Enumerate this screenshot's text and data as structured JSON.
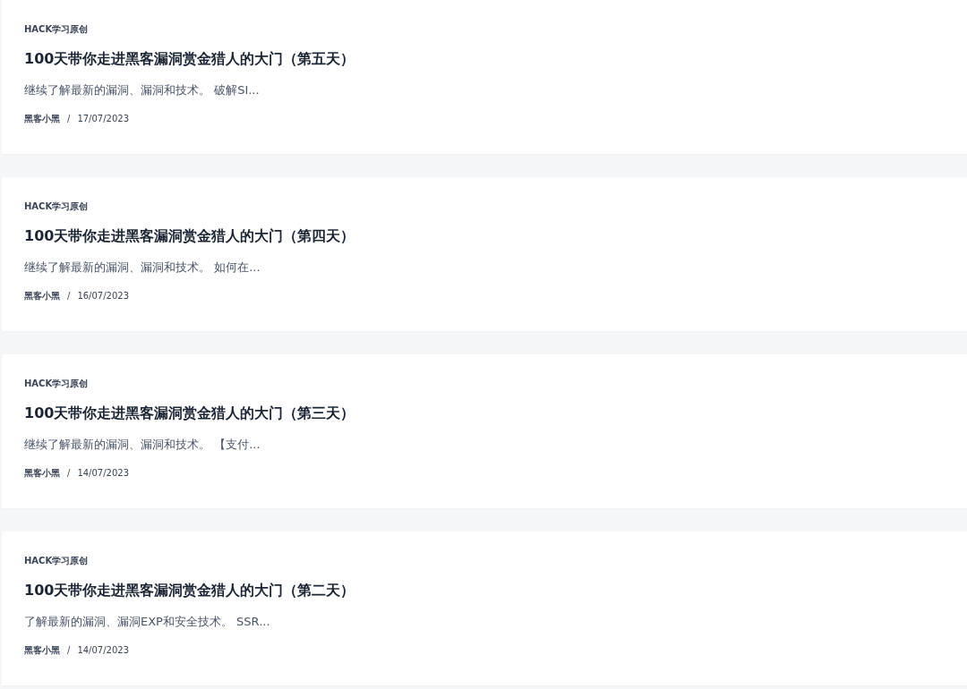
{
  "posts": [
    {
      "category": "HACK学习原创",
      "title": "100天带你走进黑客漏洞赏金猎人的大门（第五天）",
      "excerpt": "继续了解最新的漏洞、漏洞和技术。 破解SI...",
      "author": "黑客小黑",
      "separator": "/",
      "date": "17/07/2023"
    },
    {
      "category": "HACK学习原创",
      "title": "100天带你走进黑客漏洞赏金猎人的大门（第四天）",
      "excerpt": "继续了解最新的漏洞、漏洞和技术。 如何在...",
      "author": "黑客小黑",
      "separator": "/",
      "date": "16/07/2023"
    },
    {
      "category": "HACK学习原创",
      "title": "100天带你走进黑客漏洞赏金猎人的大门（第三天）",
      "excerpt": "继续了解最新的漏洞、漏洞和技术。 【支付...",
      "author": "黑客小黑",
      "separator": "/",
      "date": "14/07/2023"
    },
    {
      "category": "HACK学习原创",
      "title": "100天带你走进黑客漏洞赏金猎人的大门（第二天）",
      "excerpt": "了解最新的漏洞、漏洞EXP和安全技术。 SSR...",
      "author": "黑客小黑",
      "separator": "/",
      "date": "14/07/2023"
    }
  ]
}
